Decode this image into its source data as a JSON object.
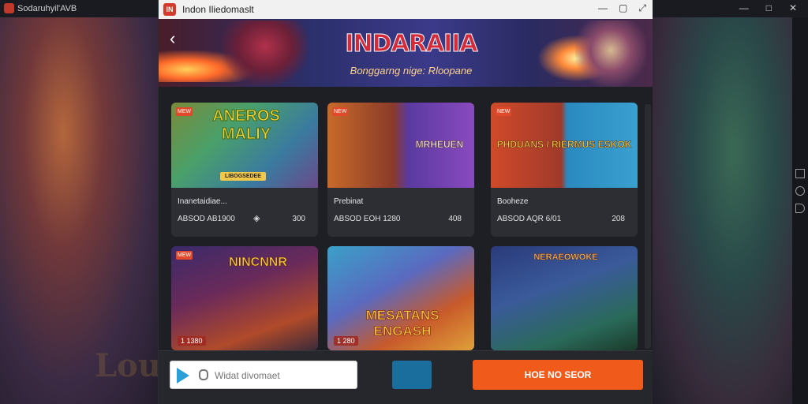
{
  "background_window": {
    "title": "Sodaruhyil'AVB",
    "controls": [
      "—",
      "□",
      "✕"
    ],
    "watermark": "Lou"
  },
  "app": {
    "title": "Indon Iliedomaslt",
    "icon_text": "IN",
    "controls": [
      "—",
      "▢",
      "⤢"
    ]
  },
  "banner": {
    "title": "INDARAIIA",
    "subtitle": "Bonggarng nige: Rloopane"
  },
  "cards_row1": [
    {
      "img_title": "ANEROS MALIY",
      "chip": "LIBOGSEDEE",
      "name": "Inanetaidiae...",
      "meta": "ABSOD AB1900",
      "count": "300",
      "badge": "MEW"
    },
    {
      "img_title": "MRHEUEN",
      "name": "Prebinat",
      "meta": "ABSOD EOH 1280",
      "count": "408",
      "badge": "NEW"
    },
    {
      "img_title": "PHDUANS / RIERMUS ESKOK",
      "name": "Booheze",
      "meta": "ABSOD AQR 6/01",
      "count": "208",
      "badge": "NEW"
    }
  ],
  "cards_row2": [
    {
      "img_title": "NINCNNR",
      "label": "1 1380",
      "badge": "MEW"
    },
    {
      "img_title": "MESATANS ENGASH",
      "label": "1 280"
    },
    {
      "img_title": "NERAEOWOKE"
    }
  ],
  "bottombar": {
    "search_placeholder": "Widat divomaet",
    "cta_label": "HOE NO SEOR"
  },
  "colors": {
    "accent": "#f05a1a",
    "secondary": "#1a6e9e",
    "banner_title": "#d42a3a",
    "badge": "#e04a2a"
  }
}
